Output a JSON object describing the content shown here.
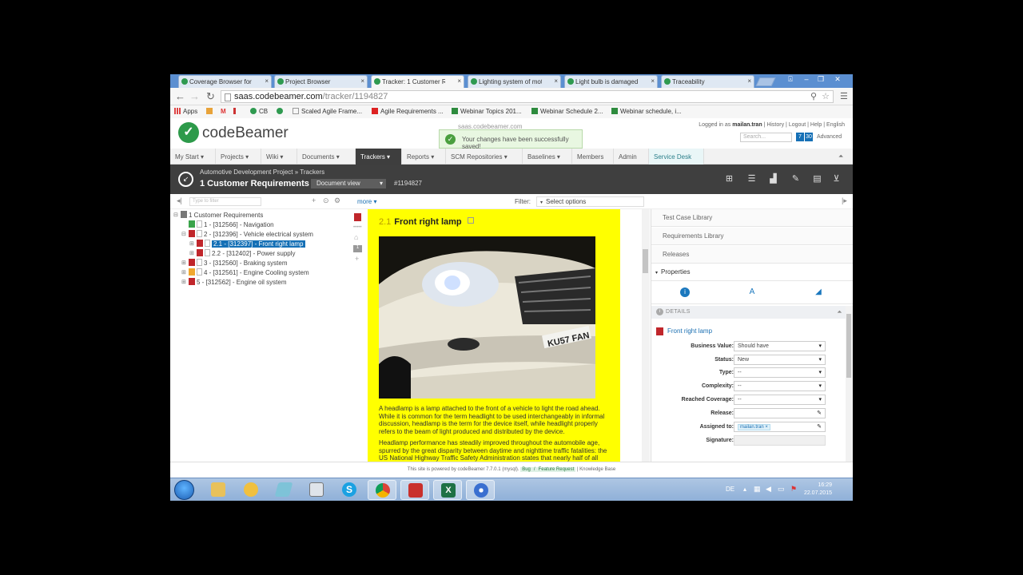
{
  "browser": {
    "tabs": [
      {
        "title": "Coverage Browser for M",
        "active": false
      },
      {
        "title": "Project Browser",
        "active": false
      },
      {
        "title": "Tracker: 1 Customer Re",
        "active": true
      },
      {
        "title": "Lighting system of mot",
        "active": false
      },
      {
        "title": "Light bulb is damaged",
        "active": false
      },
      {
        "title": "Traceability",
        "active": false
      }
    ],
    "url_host": "saas.codebeamer.com",
    "url_path": "/tracker/1194827",
    "bookmarks": [
      "Apps",
      "CB",
      "Scaled Agile Frame...",
      "Agile Requirements ...",
      "Webinar Topics 201...",
      "Webinar Schedule 2...",
      "Webinar schedule, i..."
    ]
  },
  "header": {
    "logo": "codeBeamer",
    "site_host": "saas.codebeamer.com",
    "toast": "Your changes have been successfully saved!",
    "logged_in_prefix": "Logged in as",
    "user": "mailan.tran",
    "user_links": "| History | Logout | Help | English",
    "search_placeholder": "Search...",
    "badge1": "7",
    "badge2": "30",
    "advanced": "Advanced"
  },
  "nav": {
    "items": [
      "My Start",
      "Projects",
      "Wiki",
      "Documents",
      "Trackers",
      "Reports",
      "SCM Repositories",
      "Baselines",
      "Members",
      "Admin",
      "Service Desk"
    ]
  },
  "titlebar": {
    "breadcrumb": "Automotive Development Project » Trackers",
    "tracker_name": "1 Customer Requirements",
    "view": "Document view",
    "tracker_id": "#1194827"
  },
  "toolbar": {
    "filter_placeholder": "Type to filter",
    "more": "more ▾",
    "filter_label": "Filter:",
    "filter_select": "Select options"
  },
  "tree": {
    "root": "1 Customer Requirements",
    "nodes": [
      {
        "label": "1 - [312566] - Navigation",
        "color": "#3aa44a"
      },
      {
        "label": "2 - [312396] - Vehicle electrical system",
        "color": "#c0262b"
      },
      {
        "label": "2.1 - [312397] - Front right lamp",
        "color": "#c0262b"
      },
      {
        "label": "2.2 - [312402] - Power supply",
        "color": "#c0262b"
      },
      {
        "label": "3 - [312560] - Braking system",
        "color": "#c0262b"
      },
      {
        "label": "4 - [312561] - Engine Cooling system",
        "color": "#f0a830"
      },
      {
        "label": "5 - [312562] - Engine oil system",
        "color": "#c0262b"
      }
    ]
  },
  "document": {
    "section_number": "2.1",
    "section_title": "Front right lamp",
    "para1": "A headlamp is a lamp attached to the front of a vehicle to light the road ahead. While it is common for the term headlight to be used interchangeably in informal discussion, headlamp is the term for the device itself, while headlight properly refers to the beam of light produced and distributed by the device.",
    "para2": "Headlamp performance has steadily improved throughout the automobile age, spurred by the great disparity between daytime and nighttime traffic fatalities: the US National Highway Traffic Safety Administration states that nearly half of all",
    "plate": "KU57 FAN"
  },
  "right_panel": {
    "sections": [
      "Test Case Library",
      "Requirements Library",
      "Releases",
      "Properties"
    ],
    "details_label": "DETAILS",
    "item_name": "Front right lamp",
    "fields": [
      {
        "label": "Business Value:",
        "value": "Should have"
      },
      {
        "label": "Status:",
        "value": "New"
      },
      {
        "label": "Type:",
        "value": "--"
      },
      {
        "label": "Complexity:",
        "value": "--"
      },
      {
        "label": "Reached Coverage:",
        "value": "--"
      },
      {
        "label": "Release:",
        "value": ""
      },
      {
        "label": "Assigned to:",
        "value": "mailan.tran ×"
      },
      {
        "label": "Signature:",
        "value": ""
      }
    ]
  },
  "footer": {
    "text": "This site is powered by codeBeamer 7.7.0.1 (mysql).",
    "bug": "Bug",
    "sep": "/",
    "feature": "Feature Request",
    "kb": "| Knowledge Base"
  },
  "taskbar": {
    "lang": "DE",
    "time": "16:29",
    "date": "22.07.2015"
  }
}
